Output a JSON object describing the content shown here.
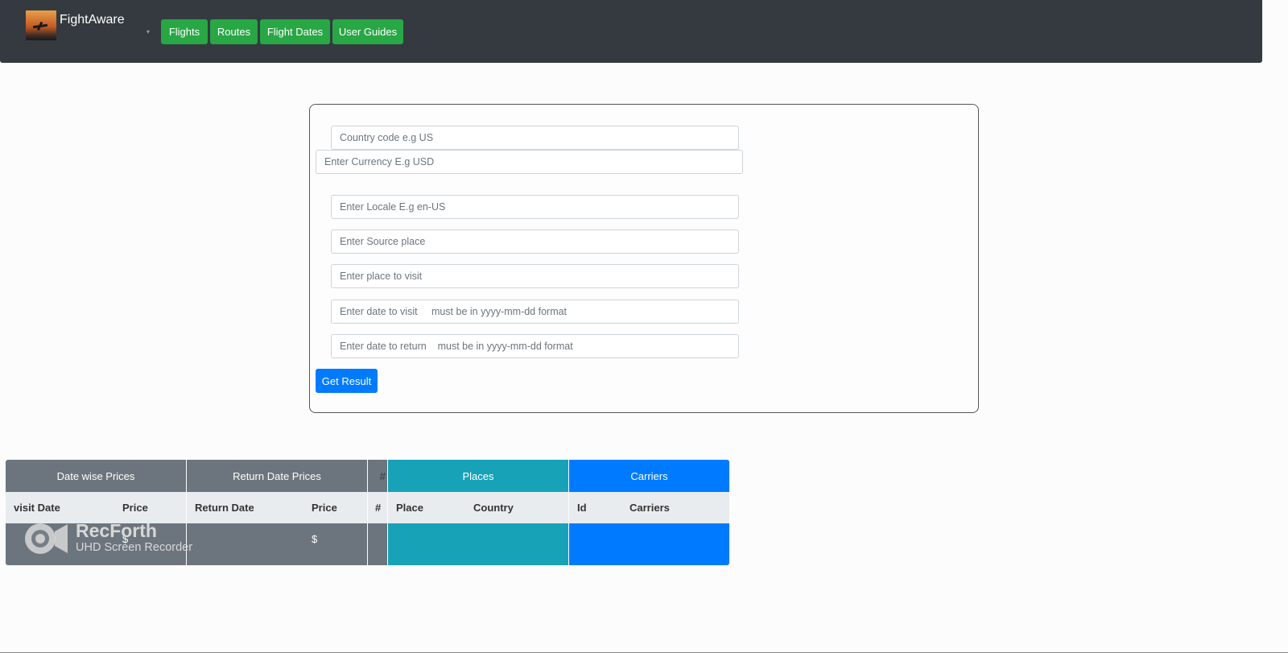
{
  "header": {
    "brand": "FightAware",
    "nav": [
      "Flights",
      "Routes",
      "Flight Dates",
      "User Guides"
    ],
    "caret": "▾"
  },
  "form": {
    "country_placeholder": "Country code e.g US",
    "currency_placeholder": "Enter Currency E.g USD",
    "locale_placeholder": "Enter Locale E.g en-US",
    "source_placeholder": "Enter Source place",
    "visit_place_placeholder": "Enter place to visit",
    "visit_date_placeholder": "Enter date to visit     must be in yyyy-mm-dd format",
    "return_date_placeholder": "Enter date to return    must be in yyyy-mm-dd format",
    "submit": "Get Result"
  },
  "tables": {
    "date_prices": {
      "title": "Date wise Prices",
      "col1": "visit Date",
      "col2": "Price",
      "value": "$"
    },
    "return_prices": {
      "title": "Return Date Prices",
      "col1": "Return Date",
      "col2": "Price",
      "value": "$"
    },
    "index_col": {
      "title": "#",
      "col": "#"
    },
    "places": {
      "title": "Places",
      "col1": "Place",
      "col2": "Country"
    },
    "carriers": {
      "title": "Carriers",
      "col1": "Id",
      "col2": "Carriers"
    }
  },
  "watermark": {
    "title": "RecForth",
    "subtitle": "UHD Screen Recorder"
  },
  "colors": {
    "nav_button": "#28a745",
    "primary": "#007bff",
    "info": "#17a2b8",
    "secondary": "#6c757d",
    "navbar": "#343a40"
  }
}
